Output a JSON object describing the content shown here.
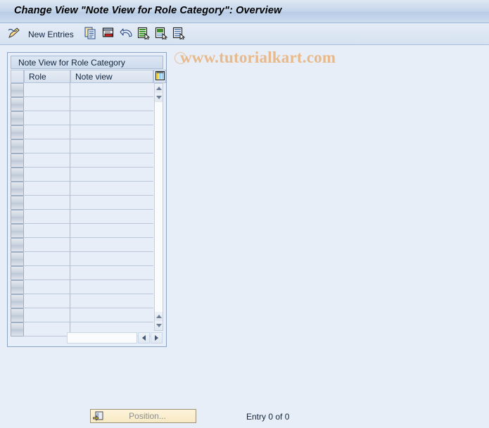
{
  "window": {
    "title": "Change View \"Note View for Role Category\": Overview"
  },
  "toolbar": {
    "edit_icon": "pencil-icon",
    "new_entries_label": "New Entries",
    "buttons": [
      {
        "icon": "copy-icon",
        "name": "copy-as-button"
      },
      {
        "icon": "delete-icon",
        "name": "delete-button"
      },
      {
        "icon": "undo-icon",
        "name": "undo-button"
      },
      {
        "icon": "select-all-icon",
        "name": "select-all-button"
      },
      {
        "icon": "select-block-icon",
        "name": "select-block-button"
      },
      {
        "icon": "deselect-all-icon",
        "name": "deselect-all-button"
      }
    ]
  },
  "watermark": {
    "text": "www.tutorialkart.com",
    "color": "#e8b98a"
  },
  "table": {
    "caption": "Note View for Role Category",
    "settings_icon": "table-settings-icon",
    "columns": [
      {
        "key": "role",
        "label": "Role"
      },
      {
        "key": "note_view",
        "label": "Note view"
      }
    ],
    "rows": [],
    "empty_row_count": 18,
    "vertical_scrollbar": {
      "up_icon": "triangle-up-icon",
      "down_icon": "triangle-down-icon"
    },
    "horizontal_scrollbar": {
      "left_icon": "triangle-left-icon",
      "right_icon": "triangle-right-icon"
    }
  },
  "footer": {
    "position_button_label": "Position...",
    "position_button_icon": "position-icon",
    "entry_status": "Entry 0 of 0"
  },
  "colors": {
    "background": "#e8eef7",
    "title_bar": "#c3d4ea",
    "panel_border": "#8ba5c4",
    "button_yellow": "#f7e9c4"
  }
}
